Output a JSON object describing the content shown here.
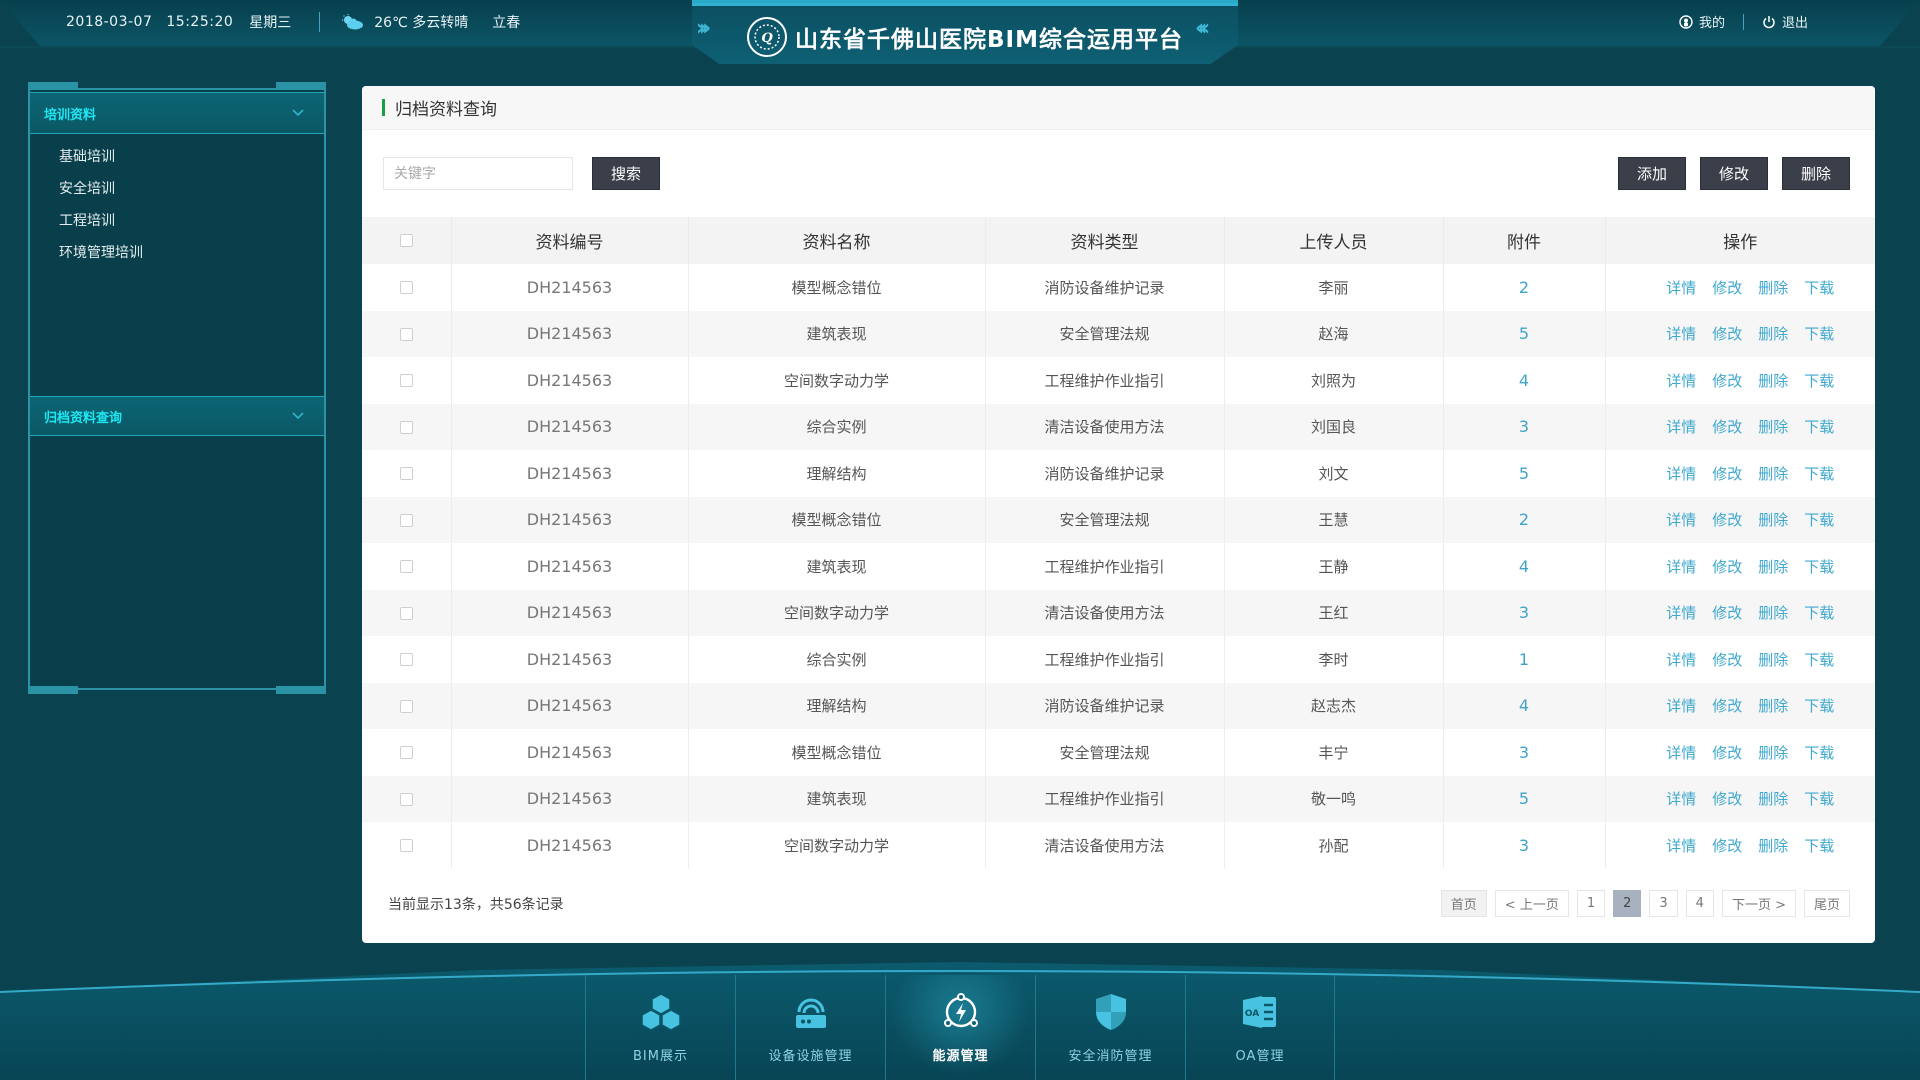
{
  "header": {
    "date": "2018-03-07",
    "time": "15:25:20",
    "weekday": "星期三",
    "weather_icon": "partly-cloudy-icon",
    "weather": "26℃ 多云转晴",
    "solar_term": "立春",
    "title": "山东省千佛山医院BIM综合运用平台",
    "logo_icon": "hospital-logo-icon",
    "my_label": "我的",
    "logout_label": "退出"
  },
  "sidebar": {
    "groups": [
      {
        "label": "培训资料",
        "items": [
          "基础培训",
          "安全培训",
          "工程培训",
          "环境管理培训"
        ]
      },
      {
        "label": "归档资料查询",
        "items": []
      }
    ]
  },
  "main": {
    "title": "归档资料查询",
    "search": {
      "placeholder": "关键字",
      "value": "",
      "button": "搜索"
    },
    "actions": {
      "add": "添加",
      "edit": "修改",
      "delete": "删除"
    },
    "table": {
      "columns": [
        "资料编号",
        "资料名称",
        "资料类型",
        "上传人员",
        "附件",
        "操作"
      ],
      "row_actions": [
        "详情",
        "修改",
        "删除",
        "下载"
      ],
      "rows": [
        {
          "code": "DH214563",
          "name": "模型概念错位",
          "type": "消防设备维护记录",
          "uploader": "李丽",
          "attachments": "2"
        },
        {
          "code": "DH214563",
          "name": "建筑表现",
          "type": "安全管理法规",
          "uploader": "赵海",
          "attachments": "5"
        },
        {
          "code": "DH214563",
          "name": "空间数字动力学",
          "type": "工程维护作业指引",
          "uploader": "刘照为",
          "attachments": "4"
        },
        {
          "code": "DH214563",
          "name": "综合实例",
          "type": "清洁设备使用方法",
          "uploader": "刘国良",
          "attachments": "3"
        },
        {
          "code": "DH214563",
          "name": "理解结构",
          "type": "消防设备维护记录",
          "uploader": "刘文",
          "attachments": "5"
        },
        {
          "code": "DH214563",
          "name": "模型概念错位",
          "type": "安全管理法规",
          "uploader": "王慧",
          "attachments": "2"
        },
        {
          "code": "DH214563",
          "name": "建筑表现",
          "type": "工程维护作业指引",
          "uploader": "王静",
          "attachments": "4"
        },
        {
          "code": "DH214563",
          "name": "空间数字动力学",
          "type": "清洁设备使用方法",
          "uploader": "王红",
          "attachments": "3"
        },
        {
          "code": "DH214563",
          "name": "综合实例",
          "type": "工程维护作业指引",
          "uploader": "李时",
          "attachments": "1"
        },
        {
          "code": "DH214563",
          "name": "理解结构",
          "type": "消防设备维护记录",
          "uploader": "赵志杰",
          "attachments": "4"
        },
        {
          "code": "DH214563",
          "name": "模型概念错位",
          "type": "安全管理法规",
          "uploader": "丰宁",
          "attachments": "3"
        },
        {
          "code": "DH214563",
          "name": "建筑表现",
          "type": "工程维护作业指引",
          "uploader": "敬一鸣",
          "attachments": "5"
        },
        {
          "code": "DH214563",
          "name": "空间数字动力学",
          "type": "清洁设备使用方法",
          "uploader": "孙配",
          "attachments": "3"
        }
      ]
    },
    "footer": {
      "summary": "当前显示13条，共56条记录",
      "pagination": {
        "first": "首页",
        "prev": "< 上一页",
        "pages": [
          "1",
          "2",
          "3",
          "4"
        ],
        "current": "2",
        "next": "下一页 >",
        "last": "尾页"
      }
    }
  },
  "bottom_nav": {
    "items": [
      {
        "label": "BIM展示",
        "icon": "cubes-icon",
        "active": false
      },
      {
        "label": "设备设施管理",
        "icon": "router-icon",
        "active": false
      },
      {
        "label": "能源管理",
        "icon": "energy-bolt-icon",
        "active": true
      },
      {
        "label": "安全消防管理",
        "icon": "shield-icon",
        "active": false
      },
      {
        "label": "OA管理",
        "icon": "oa-document-icon",
        "active": false
      }
    ]
  },
  "colors": {
    "background": "#0a434f",
    "accent_cyan": "#1ee7f4",
    "link_blue": "#3fa8cf",
    "title_bar_green": "#18a048",
    "dark_button": "#3a3f4a",
    "active_page": "#a7b1bf"
  }
}
